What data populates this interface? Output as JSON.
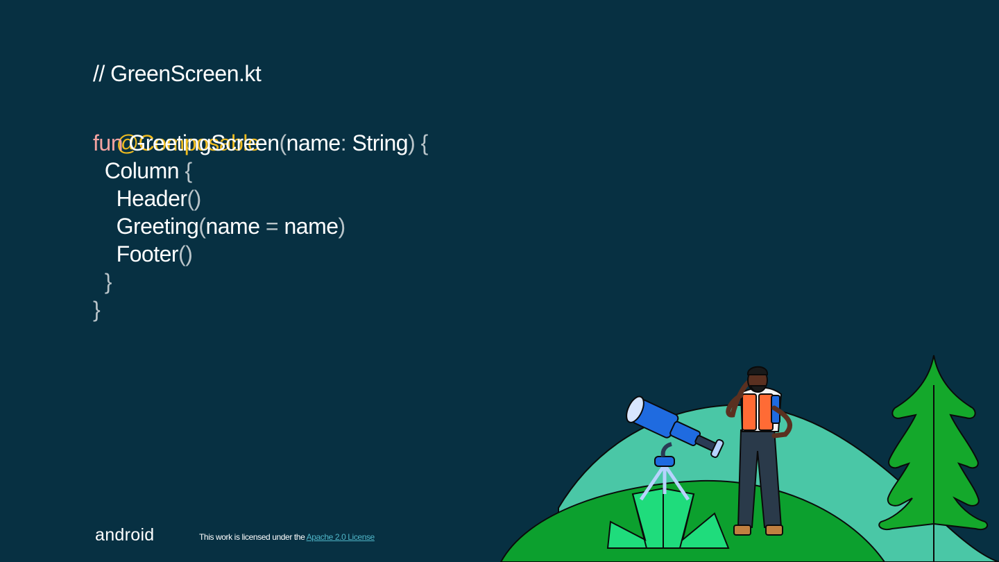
{
  "code": {
    "comment": "// GreenScreen.kt",
    "lines": [
      {
        "ann": "@Composable"
      },
      {
        "kw": "fun",
        "name": " GreetingScreen",
        "p1": "(",
        "param": "name",
        "p2": ": ",
        "type": "String",
        "p3": ") {"
      },
      {
        "indent": "  ",
        "name": "Column",
        "p1": " {"
      },
      {
        "indent": "    ",
        "name": "Header",
        "p1": "()"
      },
      {
        "indent": "    ",
        "name": "Greeting",
        "p1": "(",
        "param": "name",
        "p2": " = ",
        "arg": "name",
        "p3": ")"
      },
      {
        "indent": "    ",
        "name": "Footer",
        "p1": "()"
      },
      {
        "indent": "  ",
        "p1": "}"
      },
      {
        "p1": "}"
      }
    ]
  },
  "footer": {
    "logo": "android",
    "license_prefix": "This work is licensed under the ",
    "license_link": "Apache 2.0 License"
  },
  "colors": {
    "background": "#073042",
    "keyword": "#f5a3a0",
    "annotation": "#eebb1f",
    "punctuation": "#b9c4c9",
    "link": "#4fb6c8"
  },
  "illustration": {
    "icons": [
      "telescope-icon",
      "explorer-person-icon",
      "pine-tree-icon",
      "hill-icon",
      "bush-icon"
    ]
  }
}
